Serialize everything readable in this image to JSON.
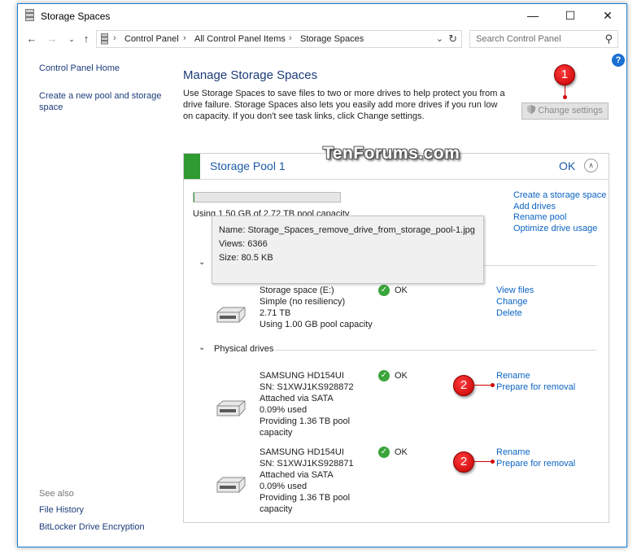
{
  "window": {
    "title": "Storage Spaces",
    "minimize": "—",
    "maximize": "☐",
    "close": "✕"
  },
  "addressbar": {
    "breadcrumbs": [
      "Control Panel",
      "All Control Panel Items",
      "Storage Spaces"
    ],
    "separator": "›",
    "search_placeholder": "Search Control Panel"
  },
  "sidebar": {
    "home": "Control Panel Home",
    "create_pool": "Create a new pool and storage space",
    "see_also": "See also",
    "see_also_links": [
      "File History",
      "BitLocker Drive Encryption"
    ]
  },
  "main": {
    "title": "Manage Storage Spaces",
    "description": "Use Storage Spaces to save files to two or more drives to help protect you from a drive failure. Storage Spaces also lets you easily add more drives if you run low on capacity. If you don't see task links, click Change settings.",
    "change_settings": "Change settings"
  },
  "pool": {
    "name": "Storage Pool 1",
    "status": "OK",
    "usage_text": "Using 1.50 GB of 2.72 TB pool capacity",
    "usage_fraction": 0.0005,
    "links": [
      "Create a storage space",
      "Add drives",
      "Rename pool",
      "Optimize drive usage"
    ]
  },
  "watermark": "TenForums.com",
  "tooltip": {
    "name": "Name: Storage_Spaces_remove_drive_from_storage_pool-1.jpg",
    "views": "Views: 6366",
    "size": "Size: 80.5 KB"
  },
  "storage_space": {
    "lines": [
      "Storage space (E:)",
      "Simple (no resiliency)",
      "2.71 TB",
      "Using 1.00 GB pool capacity"
    ],
    "status": "OK",
    "links": [
      "View files",
      "Change",
      "Delete"
    ]
  },
  "physical_drives": {
    "section_title": "Physical drives",
    "drives": [
      {
        "lines": [
          "SAMSUNG HD154UI",
          "SN: S1XWJ1KS928872",
          "Attached via SATA",
          "0.09% used",
          "Providing 1.36 TB pool capacity"
        ],
        "status": "OK",
        "links": [
          "Rename",
          "Prepare for removal"
        ]
      },
      {
        "lines": [
          "SAMSUNG HD154UI",
          "SN: S1XWJ1KS928871",
          "Attached via SATA",
          "0.09% used",
          "Providing 1.36 TB pool capacity"
        ],
        "status": "OK",
        "links": [
          "Rename",
          "Prepare for removal"
        ]
      }
    ]
  },
  "badges": [
    "1",
    "2",
    "2"
  ],
  "icons": {
    "help": "?",
    "check": "✓",
    "chevron_down": "⌄",
    "collapse": "∧"
  },
  "colors": {
    "link": "#0b64c4",
    "heading": "#1c3c7a",
    "pool_green": "#2e9a30",
    "badge_red": "#d10000"
  }
}
